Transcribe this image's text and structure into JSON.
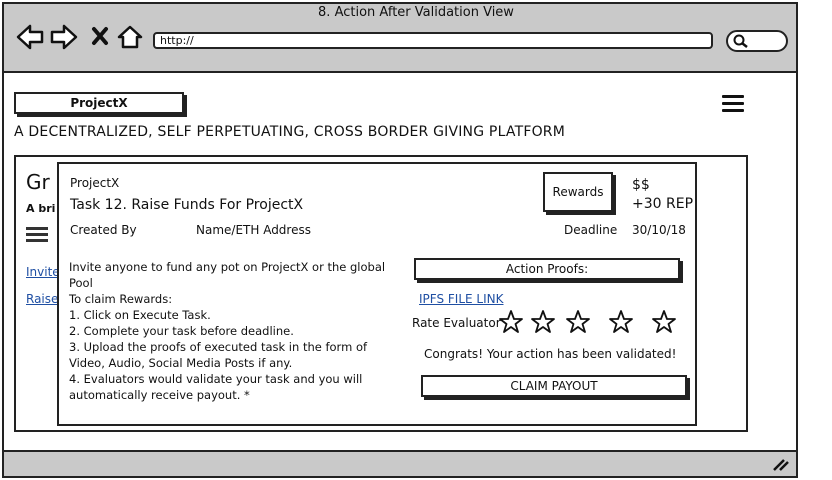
{
  "window": {
    "title": "8. Action After Validation View"
  },
  "toolbar": {
    "url": "http://"
  },
  "header": {
    "logo_label": "ProjectX",
    "tagline": "A DECENTRALIZED, SELF PERPETUATING, CROSS BORDER GIVING PLATFORM"
  },
  "background_card": {
    "title_partial": "Gr",
    "subtitle_partial": "A bri",
    "link1_partial": "Invite",
    "link2_partial": "Raise"
  },
  "modal": {
    "project": "ProjectX",
    "task_title": "Task 12.  Raise Funds For ProjectX",
    "created_by_label": "Created By",
    "creator": "Name/ETH Address",
    "rewards_label": "Rewards",
    "reward_currency": "$$",
    "reward_rep": "+30 REP",
    "deadline_label": "Deadline",
    "deadline": "30/10/18",
    "instructions": [
      "Invite anyone to fund any pot on ProjectX or the global Pool",
      "To claim Rewards:",
      "1. Click on Execute Task.",
      "2. Complete your task before deadline.",
      "3. Upload the proofs of executed task in the form of Video, Audio, Social Media Posts if any.",
      "4. Evaluators would validate your task and you will automatically receive payout. *"
    ],
    "proofs_label": "Action Proofs:",
    "ipfs_link": "IPFS FILE LINK",
    "rate_label": "Rate Evaluator",
    "rating": 0,
    "rating_max": 5,
    "congrats": "Congrats! Your action has been validated!",
    "claim_label": "CLAIM PAYOUT"
  }
}
